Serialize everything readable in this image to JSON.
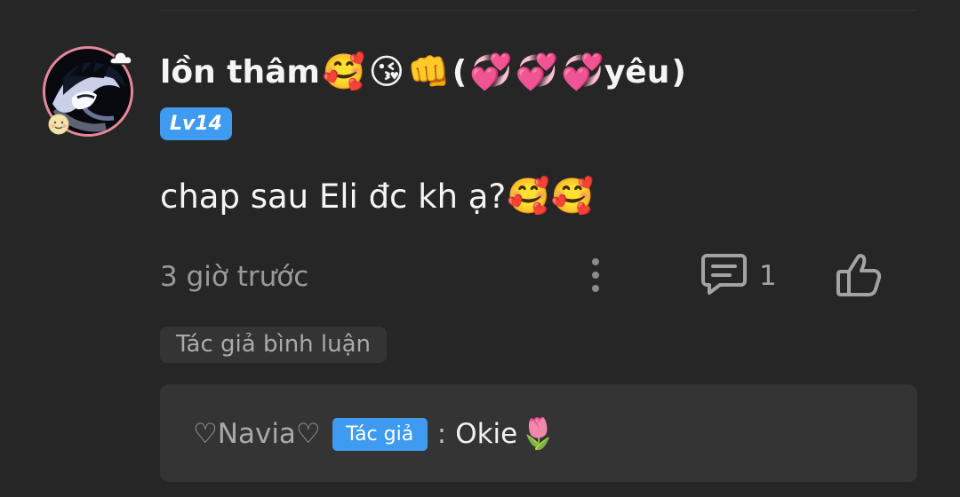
{
  "comment": {
    "avatar_icon": "user-avatar",
    "avatar_border_color": "#e7889a",
    "avatar_badges": [
      "cloud-icon",
      "smiling-face-icon"
    ],
    "username": {
      "text": "lồn thâm",
      "emojis": [
        "🥰",
        "😘",
        "👊"
      ],
      "open_paren": "(",
      "heart_emojis": [
        "💞",
        "💞",
        "💞"
      ],
      "suffix": "yêu",
      "close_paren": ")"
    },
    "level": "Lv14",
    "body": {
      "text": "chap sau Eli đc kh ạ?",
      "emojis": [
        "🥰",
        "🥰"
      ]
    },
    "timestamp": "3 giờ trước",
    "actions": {
      "more_icon": "vertical-dots-icon",
      "reply_icon": "comment-icon",
      "reply_count": "1",
      "like_icon": "thumbs-up-icon"
    },
    "author_comment_label": "Tác giả bình luận",
    "reply": {
      "author": "♡Navia♡",
      "badge": "Tác giả",
      "separator": ":",
      "text": "Okie",
      "emoji": "🌷"
    }
  },
  "colors": {
    "background": "#262626",
    "primary_text": "#f4f4f4",
    "secondary_text": "#9a9a9a",
    "accent_blue": "#3e9bf0",
    "reply_card": "#343434"
  }
}
